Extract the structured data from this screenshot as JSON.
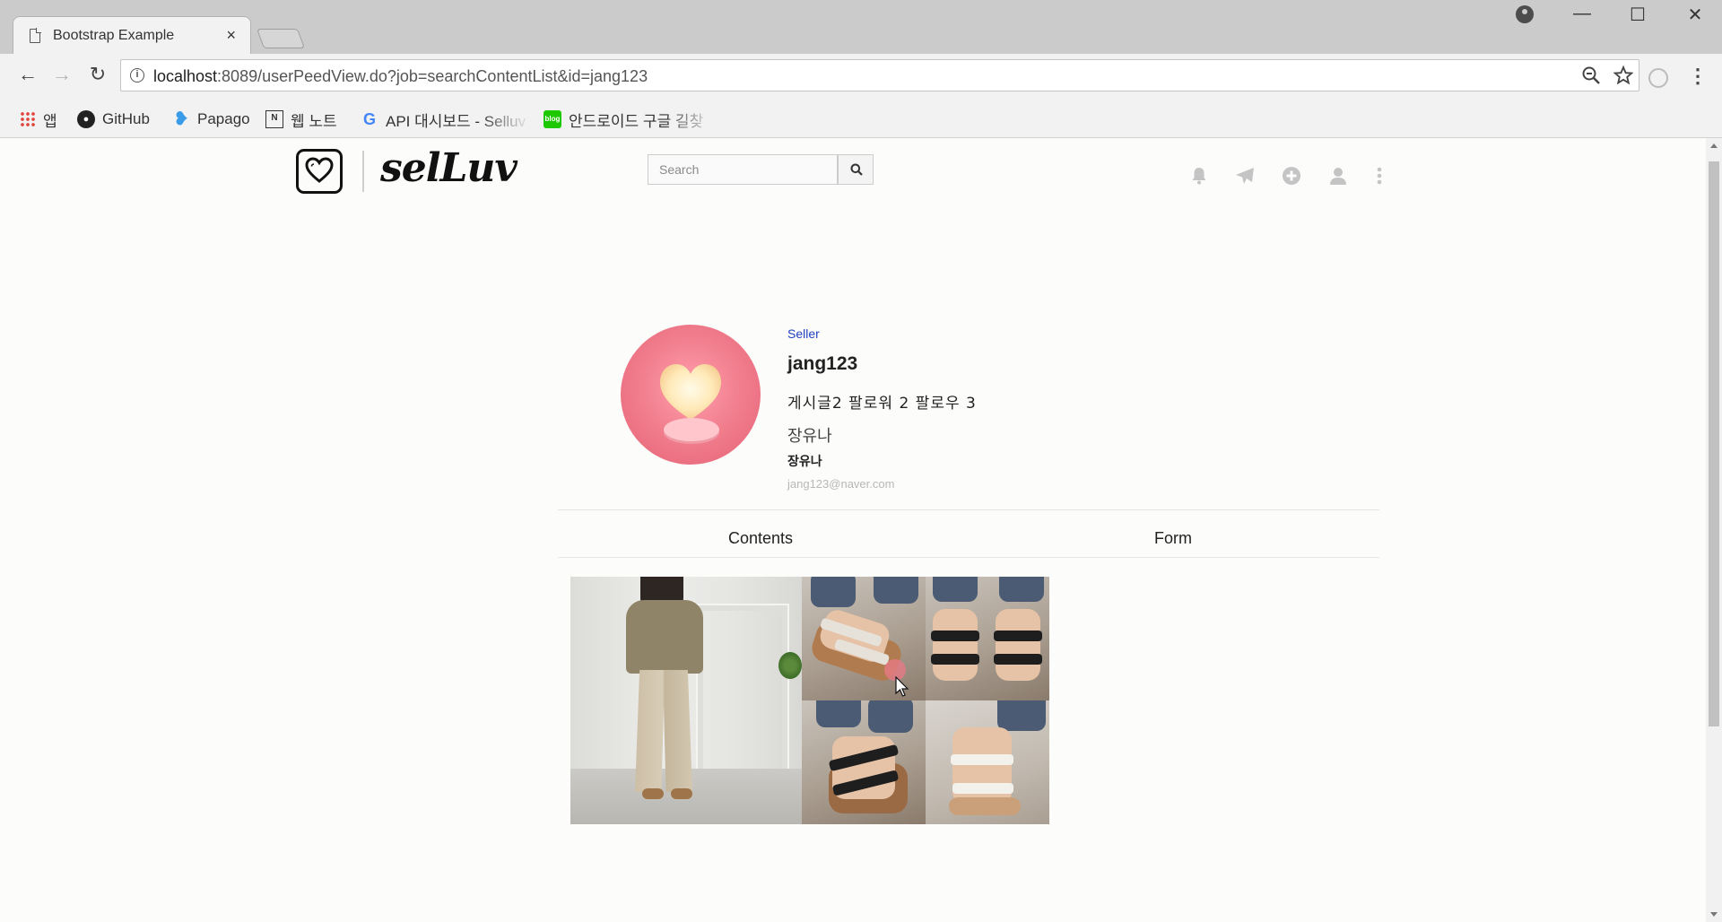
{
  "browser": {
    "tab_title": "Bootstrap Example",
    "tab_close": "×",
    "window_controls": {
      "minimize": "—",
      "maximize": "☐",
      "close": "✕"
    },
    "nav": {
      "back": "←",
      "forward": "→",
      "reload": "↻"
    },
    "url_host": "localhost",
    "url_rest": ":8089/userPeedView.do?job=searchContentList&id=jang123",
    "bookmarks": [
      {
        "label": "앱",
        "icon": "apps-grid-icon"
      },
      {
        "label": "GitHub",
        "icon": "github-icon"
      },
      {
        "label": "Papago",
        "icon": "papago-icon"
      },
      {
        "label": "웹 노트",
        "icon": "naver-note-icon"
      },
      {
        "label": "API 대시보드 - Selluv",
        "icon": "google-icon"
      },
      {
        "label": "안드로이드 구글 길찾",
        "icon": "blog-icon"
      }
    ]
  },
  "header": {
    "logo_text": "selLuv",
    "search_placeholder": "Search",
    "icons": [
      "bell-icon",
      "paper-plane-icon",
      "plus-circle-icon",
      "user-icon",
      "more-vertical-icon"
    ]
  },
  "profile": {
    "role": "Seller",
    "user_id": "jang123",
    "stats": "게시글2  팔로워 2  팔로우 3",
    "name_large": "장유나",
    "name_small": "장유나",
    "email": "jang123@naver.com"
  },
  "tabs": [
    {
      "label": "Contents"
    },
    {
      "label": "Form"
    }
  ],
  "colors": {
    "accent_link": "#1f3fbf",
    "icon_grey": "#c4c4c4"
  }
}
